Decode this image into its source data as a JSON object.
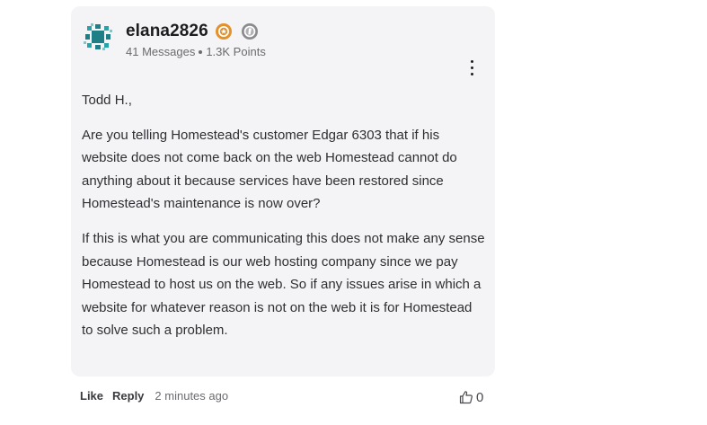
{
  "post": {
    "author": {
      "username": "elana2826",
      "messages": "41 Messages",
      "points": "1.3K Points",
      "avatar_icon": "teal-geometric-avatar",
      "rank_badge_icon": "gold-gear-badge-icon",
      "award_badge_icon": "gray-gear-badge-icon"
    },
    "menu_icon": "kebab-menu-icon",
    "paragraphs": [
      "Todd H.,",
      "Are you telling Homestead's customer Edgar 6303 that if his website does not come back on the web Homestead cannot do anything about it because services have been restored since Homestead's maintenance is now over?",
      "If this is what you are communicating this does not make any sense because Homestead is our web hosting company since we pay Homestead to host us on the web.  So if any issues arise in which a website for whatever reason is not on the web it is for Homestead to solve such a problem."
    ]
  },
  "footer": {
    "like_label": "Like",
    "reply_label": "Reply",
    "timestamp": "2 minutes ago",
    "kudos_icon": "thumbs-up-icon",
    "kudos_count": "0"
  },
  "colors": {
    "card_bg": "#f4f4f6",
    "avatar_teal": "#1f7f86",
    "badge_gold": "#e2912b",
    "badge_gray": "#8a8a8f"
  }
}
